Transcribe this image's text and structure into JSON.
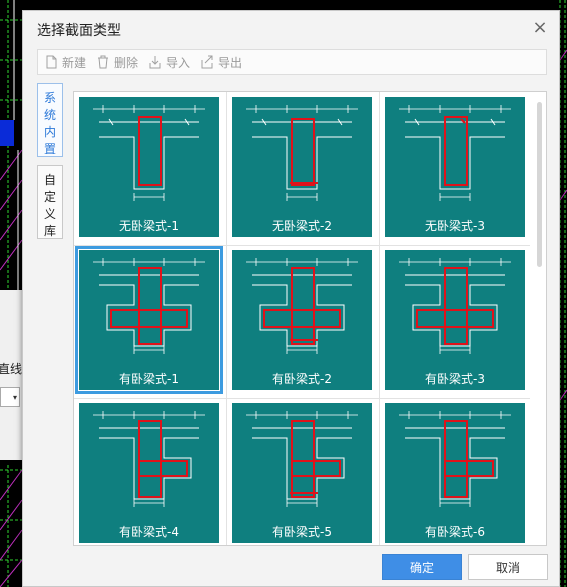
{
  "background": {
    "left_label": "直线"
  },
  "dialog": {
    "title": "选择截面类型",
    "toolbar": {
      "new_label": "新建",
      "delete_label": "删除",
      "import_label": "导入",
      "export_label": "导出"
    },
    "side_tabs": [
      {
        "label": "系统内置",
        "chars": [
          "系",
          "统",
          "内",
          "置"
        ],
        "active": true
      },
      {
        "label": "自定义库",
        "chars": [
          "自",
          "定",
          "义",
          "库"
        ],
        "active": false
      }
    ],
    "sections": [
      {
        "caption": "无卧梁式-1",
        "kind": "T",
        "selected": false
      },
      {
        "caption": "无卧梁式-2",
        "kind": "T",
        "selected": false
      },
      {
        "caption": "无卧梁式-3",
        "kind": "T",
        "selected": false
      },
      {
        "caption": "有卧梁式-1",
        "kind": "cross",
        "selected": true
      },
      {
        "caption": "有卧梁式-2",
        "kind": "cross",
        "selected": false
      },
      {
        "caption": "有卧梁式-3",
        "kind": "cross",
        "selected": false
      },
      {
        "caption": "有卧梁式-4",
        "kind": "side",
        "selected": false
      },
      {
        "caption": "有卧梁式-5",
        "kind": "side",
        "selected": false
      },
      {
        "caption": "有卧梁式-6",
        "kind": "side",
        "selected": false
      }
    ],
    "ok_label": "确定",
    "cancel_label": "取消"
  },
  "colors": {
    "thumb_bg": "#0f7f7f",
    "rebar": "#e0121a",
    "outline": "#ffffff",
    "primary": "#3f8ee6"
  }
}
